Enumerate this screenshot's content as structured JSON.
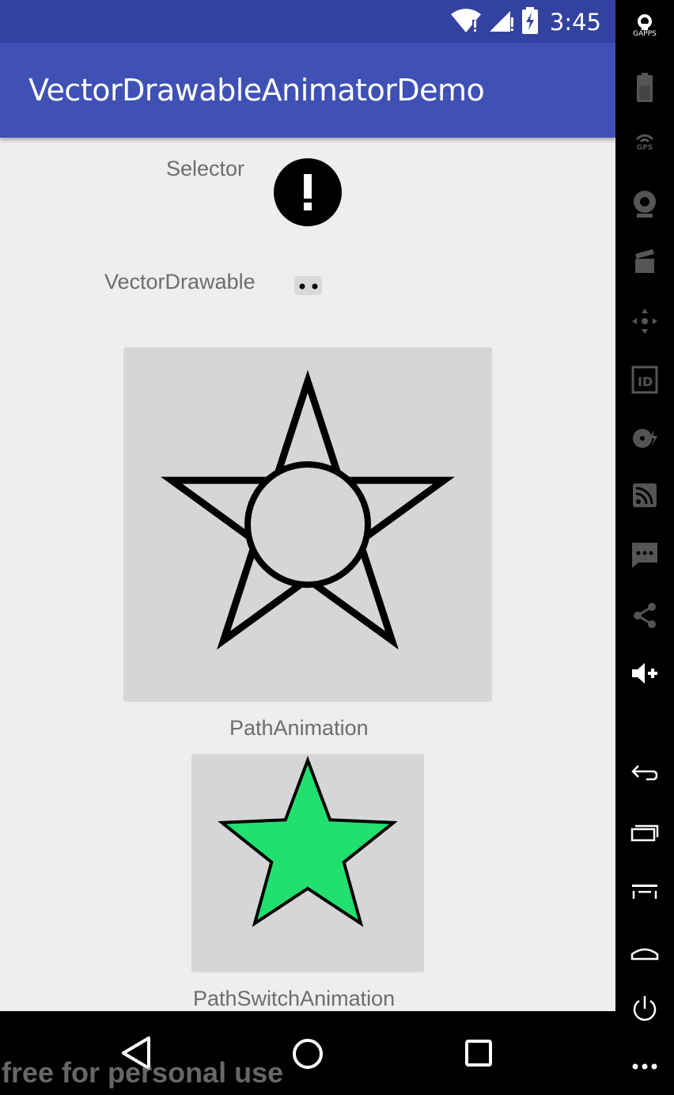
{
  "status_bar": {
    "time": "3:45",
    "icons": [
      "wifi-icon",
      "signal-icon",
      "battery-charging-icon"
    ]
  },
  "app_bar": {
    "title": "VectorDrawableAnimatorDemo"
  },
  "content": {
    "selector_label": "Selector",
    "selector_icon": "alert-circle-icon",
    "vector_drawable_label": "VectorDrawable",
    "path_animation_label": "PathAnimation",
    "path_switch_animation_label": "PathSwitchAnimation",
    "star_color": "#21e070"
  },
  "nav_bar": {
    "buttons": [
      "back-icon",
      "home-icon",
      "recents-icon"
    ],
    "watermark": "free for personal use"
  },
  "emulator_toolbar": {
    "gapps_label": "GAPPS",
    "gps_label": "GPS",
    "items": [
      "gapps-icon",
      "battery-icon",
      "gps-icon",
      "camera-icon",
      "media-icon",
      "dpad-icon",
      "id-icon",
      "disk-icon",
      "network-icon",
      "sms-icon",
      "share-icon",
      "volume-up-icon",
      "back-icon",
      "recents-icon",
      "menu-icon",
      "home-icon",
      "power-icon",
      "more-icon"
    ]
  },
  "colors": {
    "status_bar": "#3342a0",
    "app_bar": "#3f51b5",
    "background": "#eeeeee",
    "card": "#d6d6d6"
  }
}
